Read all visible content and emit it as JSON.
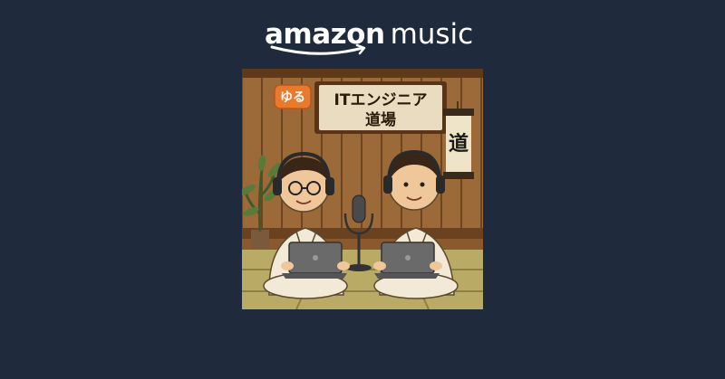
{
  "logo": {
    "word_1": "amazon",
    "word_2": "music",
    "color": "#ffffff"
  },
  "cover": {
    "badge_text": "ゆる",
    "title_line_1": "ITエンジニア",
    "title_line_2": "道場",
    "scroll_char": "道",
    "colors": {
      "background": "#1f2a3d",
      "wood_dark": "#7a4a22",
      "wood_light": "#a8743e",
      "tatami": "#b8a866",
      "badge": "#e8792d",
      "gi": "#f2ead6"
    }
  }
}
